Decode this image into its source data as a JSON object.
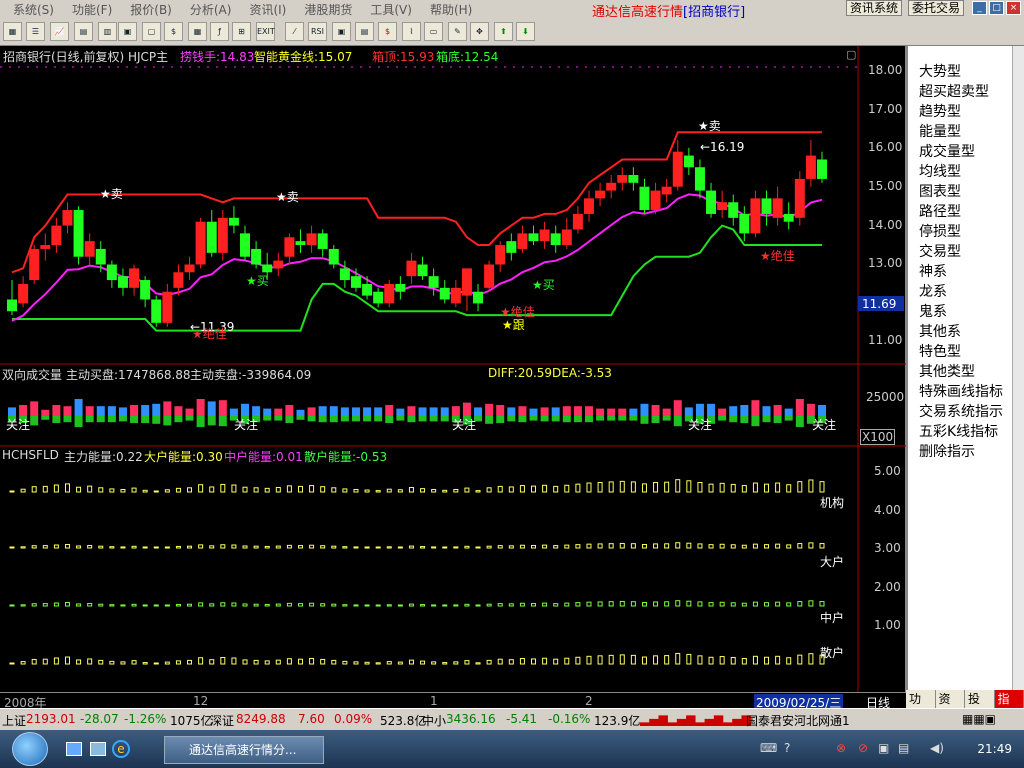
{
  "menu": {
    "items": [
      "系统(S)",
      "功能(F)",
      "报价(B)",
      "分析(A)",
      "资讯(I)",
      "港股期货",
      "工具(V)",
      "帮助(H)"
    ],
    "app_title": "通达信高速行情",
    "stock_title": "[招商银行]",
    "btn_info": "资讯系统",
    "btn_trade": "委托交易"
  },
  "main_chart": {
    "header_name": "招商银行(日线,前复权) HJCP主",
    "ind1_label": "捞钱手:14.83",
    "ind2_label": "智能黄金线:15.07",
    "ind3_label": "箱顶:15.93",
    "ind4_label": "箱底:12.54",
    "price_ticks": [
      "18.00",
      "17.00",
      "16.00",
      "15.00",
      "14.00",
      "13.00",
      "12.00",
      "11.00"
    ],
    "current_price_box": "11.69",
    "annotations": {
      "sell1": "★卖",
      "sell2": "★卖",
      "sell3": "★卖",
      "buy1": "★买",
      "buy2": "★买",
      "low_mark": "←11.39",
      "high_mark": "←16.19",
      "jueJia1": "★绝佳",
      "jueJia2": "★绝佳",
      "gen": "★跟"
    },
    "colors": {
      "up": "#ff2020",
      "down": "#20ff20",
      "yellow": "#ffff00",
      "magenta": "#ff20ff",
      "red_line": "#ff2020",
      "green_line": "#20e020"
    },
    "candles": [
      {
        "o": 12.1,
        "c": 11.8,
        "h": 12.6,
        "l": 11.7
      },
      {
        "o": 12.0,
        "c": 12.5,
        "h": 12.7,
        "l": 11.9
      },
      {
        "o": 12.6,
        "c": 13.4,
        "h": 13.5,
        "l": 12.5
      },
      {
        "o": 13.4,
        "c": 13.5,
        "h": 13.8,
        "l": 13.1
      },
      {
        "o": 13.5,
        "c": 14.0,
        "h": 14.2,
        "l": 13.3
      },
      {
        "o": 14.0,
        "c": 14.4,
        "h": 14.6,
        "l": 13.8
      },
      {
        "o": 14.4,
        "c": 13.2,
        "h": 14.5,
        "l": 13.0
      },
      {
        "o": 13.2,
        "c": 13.6,
        "h": 13.8,
        "l": 13.0
      },
      {
        "o": 13.4,
        "c": 13.0,
        "h": 13.6,
        "l": 12.8
      },
      {
        "o": 13.0,
        "c": 12.6,
        "h": 13.1,
        "l": 12.4
      },
      {
        "o": 12.7,
        "c": 12.4,
        "h": 12.9,
        "l": 12.2
      },
      {
        "o": 12.4,
        "c": 12.9,
        "h": 13.0,
        "l": 12.2
      },
      {
        "o": 12.6,
        "c": 12.1,
        "h": 12.7,
        "l": 11.9
      },
      {
        "o": 12.1,
        "c": 11.5,
        "h": 12.2,
        "l": 11.4
      },
      {
        "o": 11.5,
        "c": 12.3,
        "h": 12.5,
        "l": 11.4
      },
      {
        "o": 12.4,
        "c": 12.8,
        "h": 13.0,
        "l": 12.2
      },
      {
        "o": 12.8,
        "c": 13.0,
        "h": 13.2,
        "l": 12.6
      },
      {
        "o": 13.0,
        "c": 14.1,
        "h": 14.2,
        "l": 12.9
      },
      {
        "o": 14.1,
        "c": 13.3,
        "h": 14.4,
        "l": 13.2
      },
      {
        "o": 13.3,
        "c": 14.2,
        "h": 14.4,
        "l": 13.1
      },
      {
        "o": 14.2,
        "c": 14.0,
        "h": 14.5,
        "l": 13.8
      },
      {
        "o": 13.8,
        "c": 13.2,
        "h": 14.0,
        "l": 13.1
      },
      {
        "o": 13.4,
        "c": 13.0,
        "h": 13.6,
        "l": 12.9
      },
      {
        "o": 13.0,
        "c": 12.8,
        "h": 13.3,
        "l": 12.6
      },
      {
        "o": 12.9,
        "c": 13.1,
        "h": 13.3,
        "l": 12.7
      },
      {
        "o": 13.2,
        "c": 13.7,
        "h": 13.8,
        "l": 13.0
      },
      {
        "o": 13.6,
        "c": 13.5,
        "h": 13.9,
        "l": 13.3
      },
      {
        "o": 13.5,
        "c": 13.8,
        "h": 14.0,
        "l": 13.3
      },
      {
        "o": 13.8,
        "c": 13.4,
        "h": 13.9,
        "l": 13.2
      },
      {
        "o": 13.4,
        "c": 13.0,
        "h": 13.5,
        "l": 12.9
      },
      {
        "o": 12.9,
        "c": 12.6,
        "h": 13.1,
        "l": 12.4
      },
      {
        "o": 12.7,
        "c": 12.4,
        "h": 12.9,
        "l": 12.3
      },
      {
        "o": 12.5,
        "c": 12.2,
        "h": 12.7,
        "l": 12.1
      },
      {
        "o": 12.3,
        "c": 12.0,
        "h": 12.4,
        "l": 11.9
      },
      {
        "o": 12.0,
        "c": 12.5,
        "h": 12.6,
        "l": 11.9
      },
      {
        "o": 12.5,
        "c": 12.3,
        "h": 12.7,
        "l": 12.1
      },
      {
        "o": 12.7,
        "c": 13.1,
        "h": 13.3,
        "l": 12.5
      },
      {
        "o": 13.0,
        "c": 12.7,
        "h": 13.2,
        "l": 12.6
      },
      {
        "o": 12.7,
        "c": 12.4,
        "h": 12.9,
        "l": 12.2
      },
      {
        "o": 12.4,
        "c": 12.1,
        "h": 12.6,
        "l": 12.0
      },
      {
        "o": 12.0,
        "c": 12.4,
        "h": 12.6,
        "l": 11.9
      },
      {
        "o": 12.2,
        "c": 12.9,
        "h": 12.9,
        "l": 11.8
      },
      {
        "o": 12.3,
        "c": 12.0,
        "h": 12.5,
        "l": 11.8
      },
      {
        "o": 12.4,
        "c": 13.0,
        "h": 13.1,
        "l": 12.3
      },
      {
        "o": 13.0,
        "c": 13.5,
        "h": 13.6,
        "l": 12.8
      },
      {
        "o": 13.6,
        "c": 13.3,
        "h": 13.8,
        "l": 13.1
      },
      {
        "o": 13.4,
        "c": 13.8,
        "h": 14.0,
        "l": 13.3
      },
      {
        "o": 13.8,
        "c": 13.6,
        "h": 14.0,
        "l": 13.5
      },
      {
        "o": 13.6,
        "c": 13.9,
        "h": 14.1,
        "l": 13.4
      },
      {
        "o": 13.8,
        "c": 13.5,
        "h": 14.0,
        "l": 13.3
      },
      {
        "o": 13.5,
        "c": 13.9,
        "h": 14.2,
        "l": 13.4
      },
      {
        "o": 13.9,
        "c": 14.3,
        "h": 14.5,
        "l": 13.8
      },
      {
        "o": 14.3,
        "c": 14.7,
        "h": 14.9,
        "l": 14.1
      },
      {
        "o": 14.7,
        "c": 14.9,
        "h": 15.1,
        "l": 14.5
      },
      {
        "o": 14.9,
        "c": 15.1,
        "h": 15.3,
        "l": 14.7
      },
      {
        "o": 15.1,
        "c": 15.3,
        "h": 15.5,
        "l": 14.9
      },
      {
        "o": 15.3,
        "c": 15.1,
        "h": 15.5,
        "l": 14.9
      },
      {
        "o": 15.0,
        "c": 14.4,
        "h": 15.2,
        "l": 14.3
      },
      {
        "o": 14.4,
        "c": 14.9,
        "h": 15.1,
        "l": 14.3
      },
      {
        "o": 14.8,
        "c": 15.0,
        "h": 15.2,
        "l": 14.6
      },
      {
        "o": 15.0,
        "c": 15.9,
        "h": 16.2,
        "l": 14.9
      },
      {
        "o": 15.8,
        "c": 15.5,
        "h": 16.0,
        "l": 15.3
      },
      {
        "o": 15.5,
        "c": 14.9,
        "h": 15.7,
        "l": 14.7
      },
      {
        "o": 14.9,
        "c": 14.3,
        "h": 15.1,
        "l": 14.2
      },
      {
        "o": 14.4,
        "c": 14.6,
        "h": 14.9,
        "l": 14.2
      },
      {
        "o": 14.6,
        "c": 14.2,
        "h": 14.8,
        "l": 14.0
      },
      {
        "o": 14.3,
        "c": 13.8,
        "h": 14.5,
        "l": 13.6
      },
      {
        "o": 13.8,
        "c": 14.7,
        "h": 14.9,
        "l": 13.7
      },
      {
        "o": 14.7,
        "c": 14.3,
        "h": 14.9,
        "l": 14.0
      },
      {
        "o": 14.2,
        "c": 14.7,
        "h": 15.0,
        "l": 14.0
      },
      {
        "o": 14.3,
        "c": 14.1,
        "h": 14.6,
        "l": 13.9
      },
      {
        "o": 14.2,
        "c": 15.2,
        "h": 15.4,
        "l": 14.0
      },
      {
        "o": 15.2,
        "c": 15.8,
        "h": 16.2,
        "l": 15.0
      },
      {
        "o": 15.7,
        "c": 15.2,
        "h": 15.9,
        "l": 15.1
      }
    ]
  },
  "volume_panel": {
    "label": "双向成交量",
    "buy_label": "主动买盘:1747868.88",
    "sell_label": "主动卖盘:-339864.09",
    "diff_label": "DIFF:20.59",
    "dea_label": "DEA:-3.53",
    "tick": "25000",
    "unit": "X100",
    "focus_label": "关注"
  },
  "energy_panel": {
    "label": "HCHSFLD",
    "main_label": "主力能量:0.22",
    "big_label": "大户能量:0.30",
    "mid_label": "中户能量:0.01",
    "retail_label": "散户能量:-0.53",
    "ticks": [
      "5.00",
      "4.00",
      "3.00",
      "2.00",
      "1.00"
    ],
    "row_labels": [
      "机构",
      "大户",
      "中户",
      "散户"
    ]
  },
  "time_axis": {
    "labels": [
      "2008年",
      "12",
      "1",
      "2"
    ],
    "current_date": "2009/02/25/三",
    "period": "日线"
  },
  "sidebar": {
    "items": [
      "大势型",
      "超买超卖型",
      "趋势型",
      "能量型",
      "成交量型",
      "均线型",
      "图表型",
      "路径型",
      "停损型",
      "交易型",
      "神系",
      "龙系",
      "鬼系",
      "其他系",
      "特色型",
      "其他类型",
      "特殊画线指标",
      "交易系统指示",
      "五彩K线指标",
      "删除指示"
    ],
    "tabs": [
      "功能",
      "资讯",
      "投票",
      "指标"
    ]
  },
  "status": {
    "sh_name": "上证",
    "sh_val": "2193.01",
    "sh_chg": "-28.07",
    "sh_pct": "-1.26%",
    "sh_amt": "1075亿",
    "sz_name": "深证",
    "sz_val": "8249.88",
    "sz_chg": "7.60",
    "sz_pct": "0.09%",
    "sz_amt": "523.8亿",
    "zx_name": "中小",
    "zx_val": "3436.16",
    "zx_chg": "-5.41",
    "zx_pct": "-0.16%",
    "zx_amt": "123.9亿",
    "broker": "国泰君安河北网通1"
  },
  "taskbar": {
    "task_label": "通达信高速行情分...",
    "clock": "21:49"
  }
}
